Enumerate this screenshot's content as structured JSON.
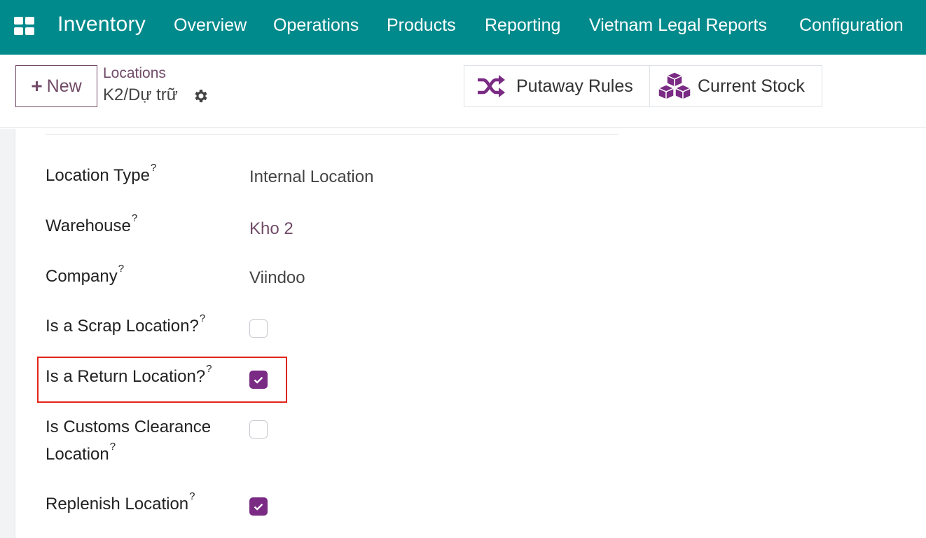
{
  "navbar": {
    "brand": "Inventory",
    "menu": [
      "Overview",
      "Operations",
      "Products",
      "Reporting",
      "Vietnam Legal Reports",
      "Configuration"
    ]
  },
  "control": {
    "new_label": "New",
    "breadcrumb": "Locations",
    "record_name": "K2/Dự trữ",
    "smart_buttons": [
      "Putaway Rules",
      "Current Stock"
    ]
  },
  "form": {
    "location_type": {
      "label": "Location Type",
      "value": "Internal Location"
    },
    "warehouse": {
      "label": "Warehouse",
      "value": "Kho 2"
    },
    "company": {
      "label": "Company",
      "value": "Viindoo"
    },
    "scrap": {
      "label": "Is a Scrap Location?",
      "checked": false
    },
    "return": {
      "label": "Is a Return Location?",
      "checked": true
    },
    "customs": {
      "label_line1": "Is Customs Clearance",
      "label_line2": "Location",
      "checked": false
    },
    "replenish": {
      "label": "Replenish Location",
      "checked": true
    },
    "help_mark": "?"
  },
  "colors": {
    "navbar": "#018a8c",
    "accent": "#714b67",
    "checkbox_checked": "#7a2b84",
    "highlight": "#e1251b"
  }
}
